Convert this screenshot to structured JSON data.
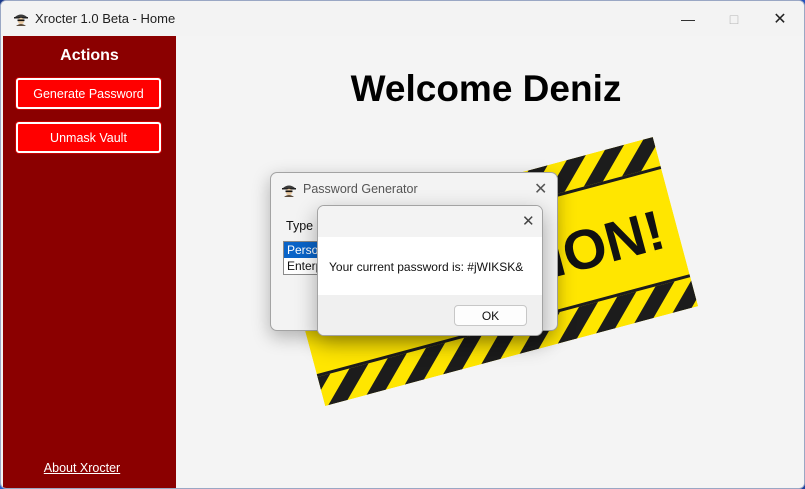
{
  "window": {
    "title": "Xrocter 1.0 Beta - Home",
    "icons": {
      "app": "spy-icon",
      "minimize": "minimize-icon",
      "maximize": "maximize-icon",
      "close": "close-icon"
    }
  },
  "sidebar": {
    "heading": "Actions",
    "buttons": [
      {
        "label": "Generate Password"
      },
      {
        "label": "Unmask Vault"
      }
    ],
    "about_link": "About Xrocter",
    "colors": {
      "background": "#8b0000",
      "button": "#ff0000"
    }
  },
  "main": {
    "welcome": "Welcome Deniz",
    "banner_text": "UCTION!",
    "banner_icon": "under-construction-banner"
  },
  "password_generator": {
    "title": "Password Generator",
    "type_label": "Type o",
    "list_items": [
      "Perso",
      "Enterp"
    ],
    "selected_index": 0
  },
  "message_box": {
    "message": "Your current password is: #jWIKSK&",
    "ok_label": "OK"
  }
}
